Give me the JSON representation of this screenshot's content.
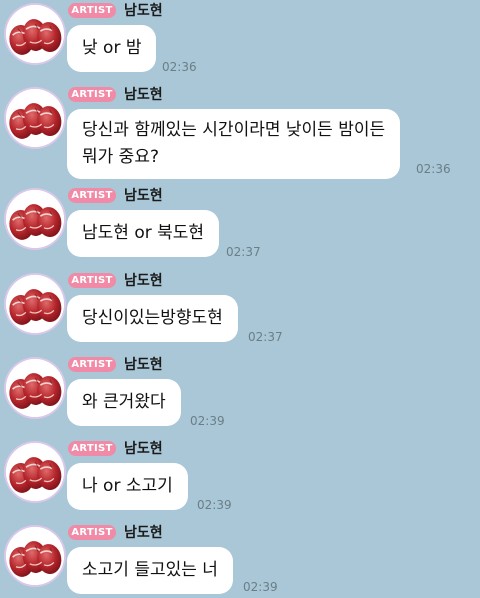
{
  "chat": {
    "badge": "ARTIST",
    "sender": "남도현",
    "messages": [
      {
        "lines": [
          "낮 or 밤"
        ],
        "time": "02:36"
      },
      {
        "lines": [
          "당신과 함께있는 시간이라면 낮이든 밤이든",
          "뭐가 중요?"
        ],
        "time": "02:36"
      },
      {
        "lines": [
          "남도현 or 북도현"
        ],
        "time": "02:37"
      },
      {
        "lines": [
          "당신이있는방향도현"
        ],
        "time": "02:37"
      },
      {
        "lines": [
          "와 큰거왔다"
        ],
        "time": "02:39"
      },
      {
        "lines": [
          "나 or 소고기"
        ],
        "time": "02:39"
      },
      {
        "lines": [
          "소고기 들고있는 너"
        ],
        "time": "02:39"
      }
    ]
  },
  "colors": {
    "background": "#a9c7d6",
    "bubble": "#ffffff",
    "badge": "#f08aa6",
    "time": "#6b7e88"
  },
  "icons": {
    "avatar": "profile-photo-raw-meat"
  }
}
